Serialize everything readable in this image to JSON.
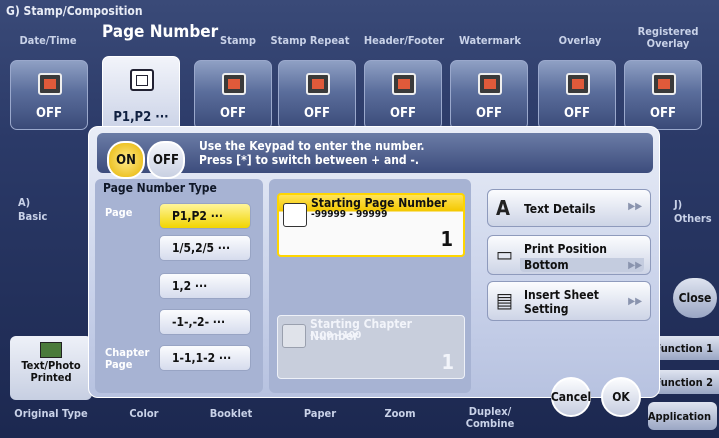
{
  "screen": {
    "title": "G)  Stamp/Composition",
    "tabs": [
      "Date/Time",
      "Page Number",
      "Stamp",
      "Stamp Repeat",
      "Header/Footer",
      "Watermark",
      "Overlay",
      "Registered Overlay"
    ],
    "tiles": [
      {
        "label": "OFF",
        "icon": "date-stamp-icon"
      },
      {
        "label": "P1,P2 ···",
        "icon": "page-number-icon"
      },
      {
        "label": "OFF",
        "icon": "stamp-icon"
      },
      {
        "label": "OFF",
        "icon": "stamp-repeat-icon"
      },
      {
        "label": "OFF",
        "icon": "header-footer-icon"
      },
      {
        "label": "OFF",
        "icon": "watermark-icon"
      },
      {
        "label": "OFF",
        "icon": "overlay-icon"
      },
      {
        "label": "OFF",
        "icon": "registered-overlay-icon"
      }
    ],
    "left_section": {
      "letter": "A)",
      "name": "Basic"
    },
    "right_section": {
      "letter": "J)",
      "name": "Others"
    },
    "close_label": "Close",
    "function_buttons": [
      "Function 1",
      "Function 2"
    ],
    "application_label": "Application",
    "original_type_tile": "Text/Photo Printed",
    "bottom_tabs": [
      "Original Type",
      "Color",
      "Booklet",
      "Paper",
      "Zoom",
      "Duplex/ Combine"
    ]
  },
  "modal": {
    "on_label": "ON",
    "off_label": "OFF",
    "instruction_line1": "Use the Keypad to enter the number.",
    "instruction_line2": "Press [*] to switch between + and -.",
    "page_number_type": {
      "title": "Page Number Type",
      "page_label": "Page",
      "chapter_label": "Chapter Page",
      "options": [
        "P1,P2 ···",
        "1/5,2/5 ···",
        "1,2 ···",
        "-1-,-2- ···",
        "1-1,1-2 ···"
      ],
      "selected": "P1,P2 ···"
    },
    "starting_page": {
      "label": "Starting Page Number",
      "range": "-99999 - 99999",
      "value": "1"
    },
    "starting_chapter": {
      "label": "Starting Chapter Number",
      "range": "-100 - 100",
      "value": "1"
    },
    "text_details_label": "Text Details",
    "print_position": {
      "label": "Print Position",
      "value": "Bottom"
    },
    "insert_sheet_label": "Insert Sheet Setting",
    "cancel_label": "Cancel",
    "ok_label": "OK"
  },
  "colors": {
    "selected_yellow": "#f1d400",
    "modal_panel": "#a7b3d3",
    "screen_blue": "#2b3a68"
  }
}
